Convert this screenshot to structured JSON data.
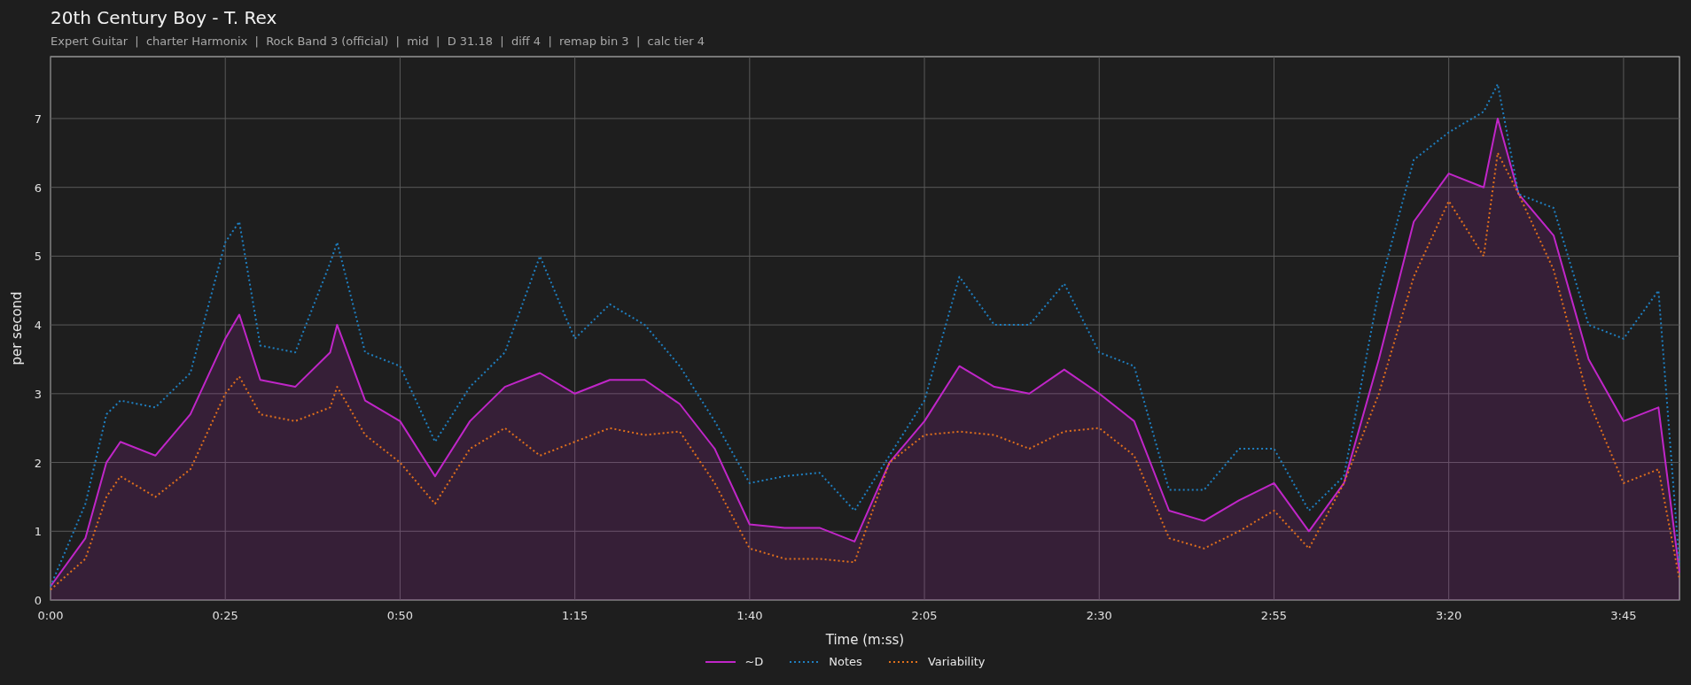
{
  "title": "20th Century Boy - T. Rex",
  "subtitle": "Expert Guitar  |  charter Harmonix  |  Rock Band 3 (official)  |  mid  |  D 31.18  |  diff 4  |  remap bin 3  |  calc tier 4",
  "chart_data": {
    "type": "line",
    "xlabel": "Time (m:ss)",
    "ylabel": "per second",
    "x": [
      0,
      5,
      8,
      10,
      15,
      20,
      25,
      27,
      30,
      35,
      40,
      41,
      45,
      50,
      55,
      60,
      65,
      70,
      75,
      80,
      85,
      90,
      95,
      100,
      105,
      110,
      115,
      120,
      125,
      130,
      135,
      140,
      145,
      150,
      155,
      160,
      165,
      170,
      175,
      180,
      185,
      190,
      195,
      200,
      205,
      207,
      210,
      215,
      220,
      225,
      230,
      233
    ],
    "series": [
      {
        "name": "~D",
        "color": "#c026c8",
        "line_style": "solid",
        "type": "area",
        "values": [
          0.2,
          0.9,
          2.0,
          2.3,
          2.1,
          2.7,
          3.8,
          4.15,
          3.2,
          3.1,
          3.6,
          4.0,
          2.9,
          2.6,
          1.8,
          2.6,
          3.1,
          3.3,
          3.0,
          3.2,
          3.2,
          2.85,
          2.2,
          1.1,
          1.05,
          1.05,
          0.85,
          2.0,
          2.6,
          3.4,
          3.1,
          3.0,
          3.35,
          3.0,
          2.6,
          1.3,
          1.15,
          1.45,
          1.7,
          1.0,
          1.7,
          3.5,
          5.5,
          6.2,
          6.0,
          7.0,
          5.9,
          5.3,
          3.5,
          2.6,
          2.8,
          0.4
        ]
      },
      {
        "name": "Notes",
        "color": "#1f7fc0",
        "line_style": "dotted",
        "type": "line",
        "values": [
          0.2,
          1.4,
          2.7,
          2.9,
          2.8,
          3.3,
          5.2,
          5.5,
          3.7,
          3.6,
          4.9,
          5.2,
          3.6,
          3.4,
          2.3,
          3.1,
          3.6,
          5.0,
          3.8,
          4.3,
          4.0,
          3.4,
          2.6,
          1.7,
          1.8,
          1.85,
          1.3,
          2.1,
          2.9,
          4.7,
          4.0,
          4.0,
          4.6,
          3.6,
          3.4,
          1.6,
          1.6,
          2.2,
          2.2,
          1.3,
          1.8,
          4.5,
          6.4,
          6.8,
          7.1,
          7.5,
          5.9,
          5.7,
          4.0,
          3.8,
          4.5,
          0.5
        ]
      },
      {
        "name": "Variability",
        "color": "#e0701c",
        "line_style": "dotted",
        "type": "line",
        "values": [
          0.15,
          0.6,
          1.5,
          1.8,
          1.5,
          1.9,
          3.0,
          3.25,
          2.7,
          2.6,
          2.8,
          3.1,
          2.4,
          2.0,
          1.4,
          2.2,
          2.5,
          2.1,
          2.3,
          2.5,
          2.4,
          2.45,
          1.7,
          0.75,
          0.6,
          0.6,
          0.55,
          2.0,
          2.4,
          2.45,
          2.4,
          2.2,
          2.45,
          2.5,
          2.1,
          0.9,
          0.75,
          1.0,
          1.3,
          0.75,
          1.7,
          3.0,
          4.7,
          5.8,
          5.0,
          6.5,
          5.9,
          4.8,
          2.9,
          1.7,
          1.9,
          0.3
        ]
      }
    ],
    "grid": true,
    "xlim": [
      0,
      233
    ],
    "ylim": [
      0,
      7.9
    ],
    "xticks": [
      {
        "value": 0,
        "label": "0:00"
      },
      {
        "value": 25,
        "label": "0:25"
      },
      {
        "value": 50,
        "label": "0:50"
      },
      {
        "value": 75,
        "label": "1:15"
      },
      {
        "value": 100,
        "label": "1:40"
      },
      {
        "value": 125,
        "label": "2:05"
      },
      {
        "value": 150,
        "label": "2:30"
      },
      {
        "value": 175,
        "label": "2:55"
      },
      {
        "value": 200,
        "label": "3:20"
      },
      {
        "value": 225,
        "label": "3:45"
      }
    ],
    "yticks": [
      0,
      1,
      2,
      3,
      4,
      5,
      6,
      7
    ]
  }
}
